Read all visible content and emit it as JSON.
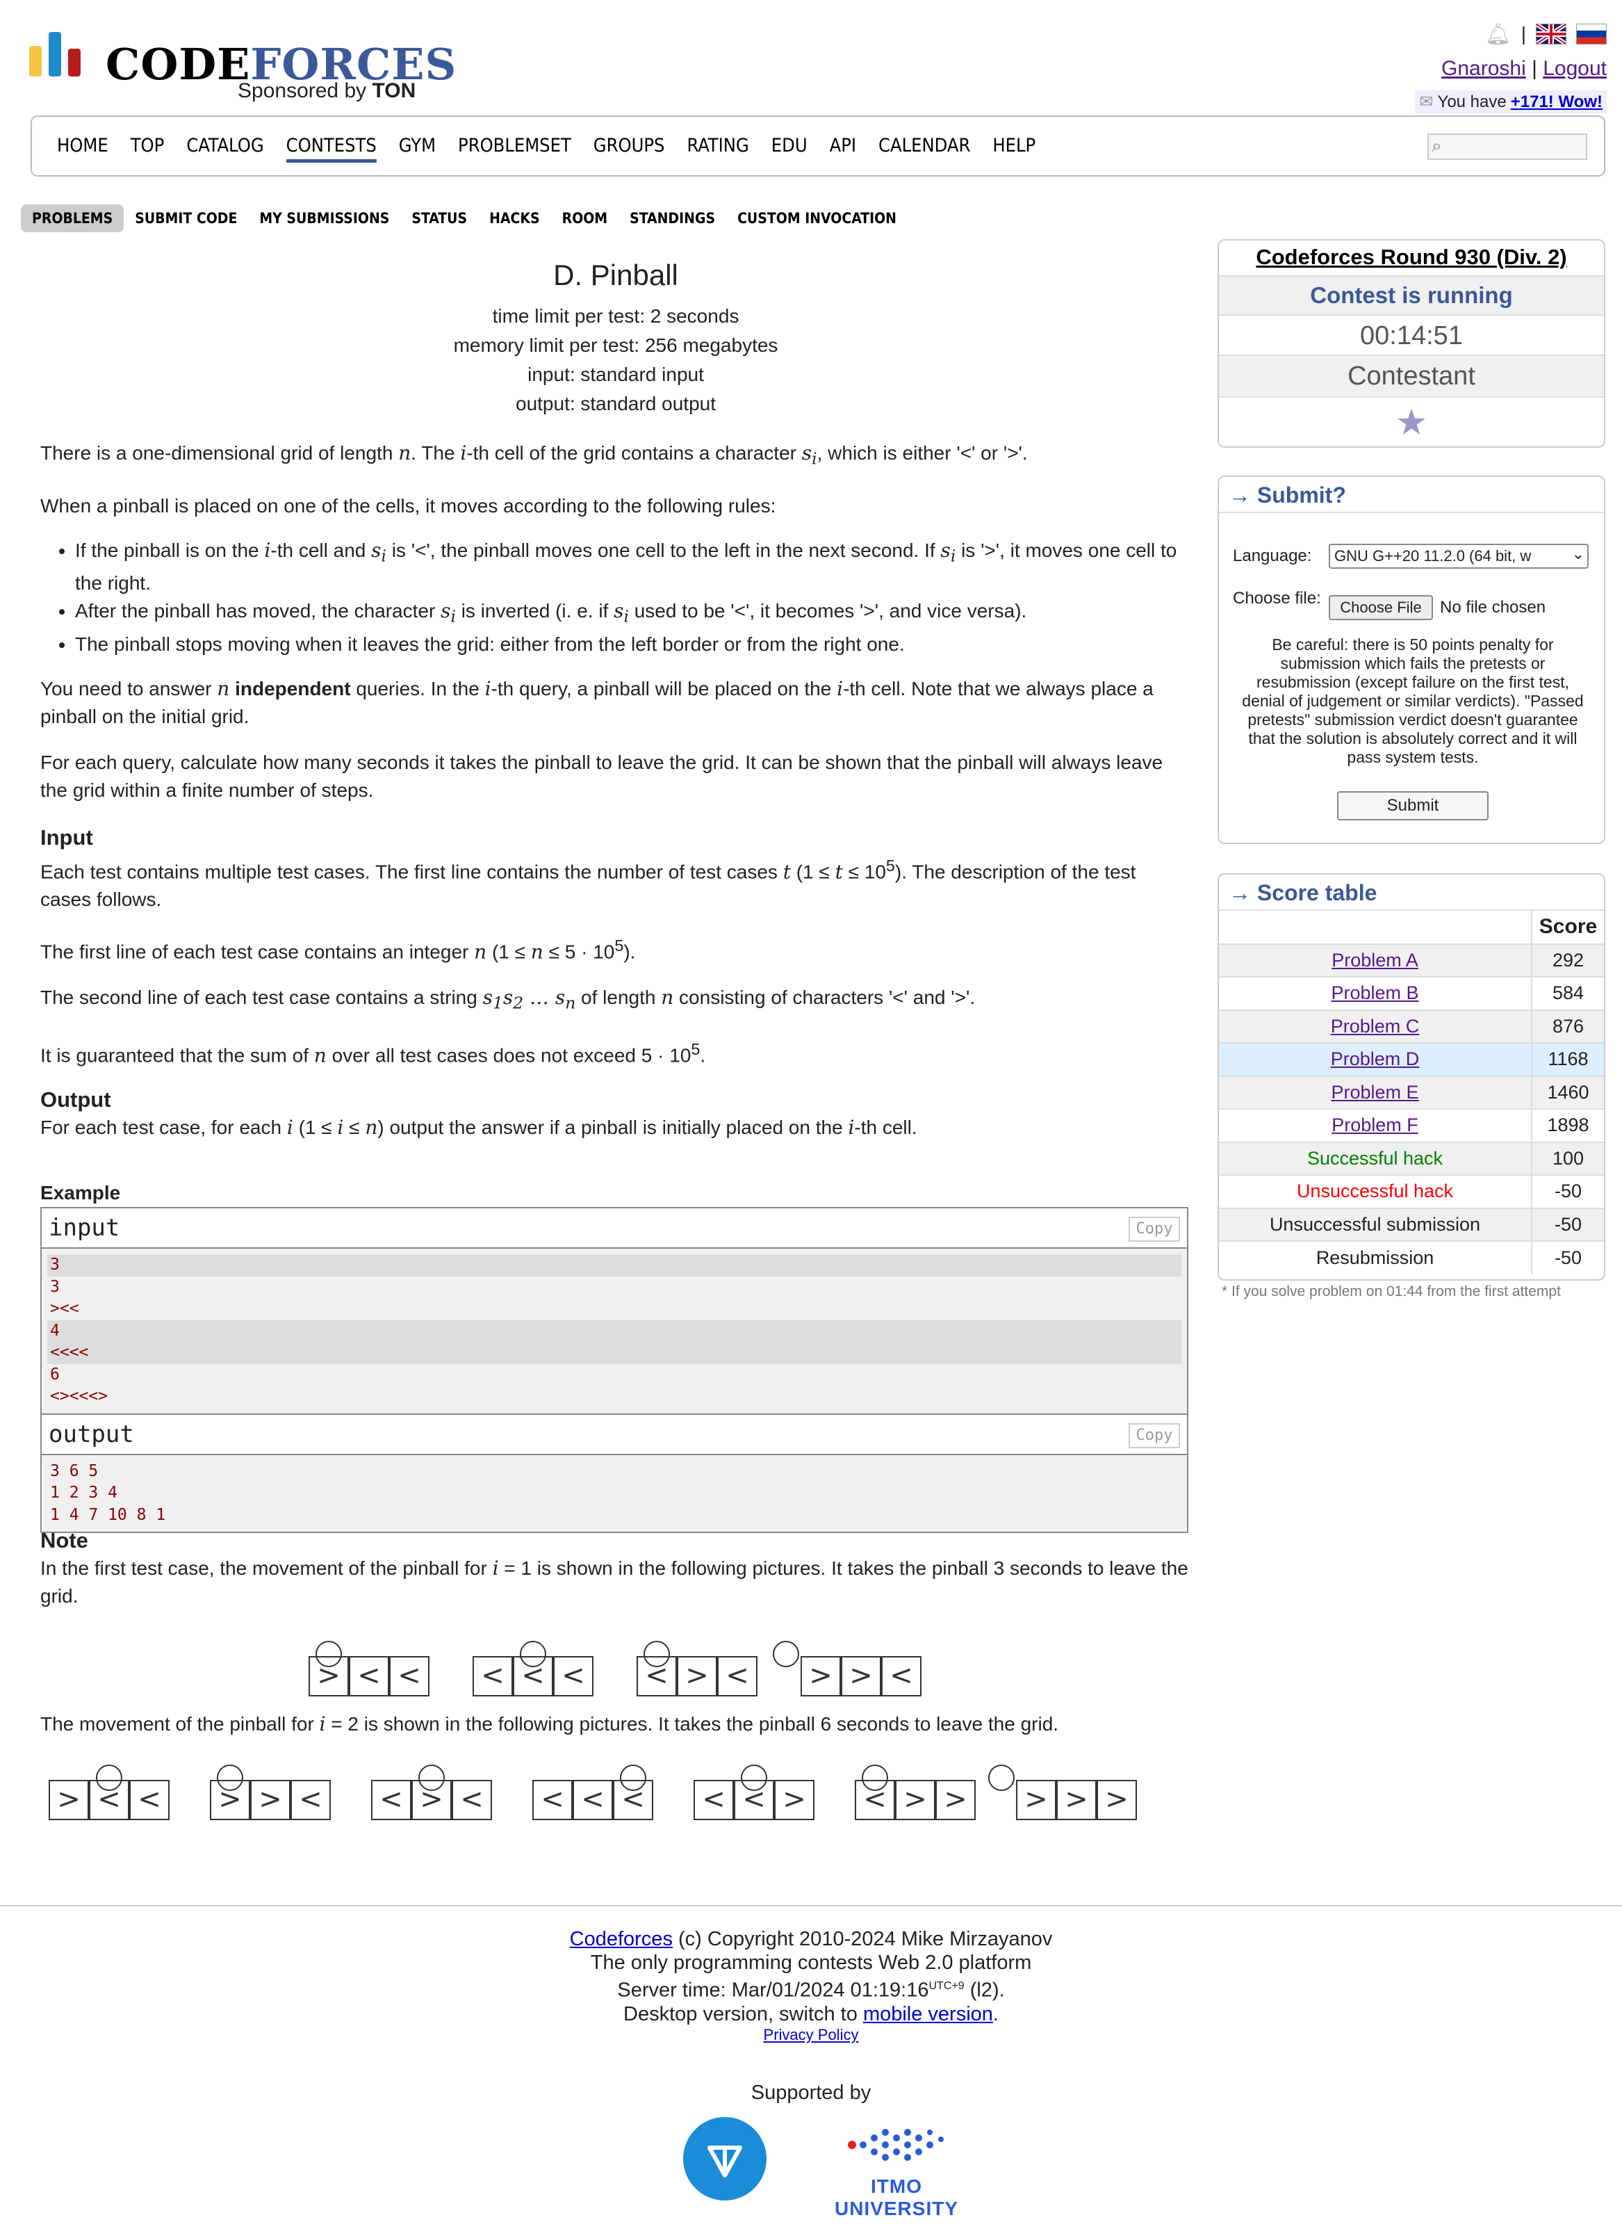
{
  "header": {
    "logo_text_code": "CODE",
    "logo_text_forces": "FORCES",
    "sponsor_prefix": "Sponsored by",
    "sponsor_name": "TON",
    "separator": "|",
    "user_name": "Gnaroshi",
    "logout": "Logout",
    "message_prefix": "You have",
    "message_link": "+171! Wow!"
  },
  "menu": [
    "HOME",
    "TOP",
    "CATALOG",
    "CONTESTS",
    "GYM",
    "PROBLEMSET",
    "GROUPS",
    "RATING",
    "EDU",
    "API",
    "CALENDAR",
    "HELP"
  ],
  "menu_active": "CONTESTS",
  "subnav": [
    "PROBLEMS",
    "SUBMIT CODE",
    "MY SUBMISSIONS",
    "STATUS",
    "HACKS",
    "ROOM",
    "STANDINGS",
    "CUSTOM INVOCATION"
  ],
  "problem": {
    "title": "D. Pinball",
    "limits": [
      "time limit per test: 2 seconds",
      "memory limit per test: 256 megabytes",
      "input: standard input",
      "output: standard output"
    ],
    "section_input": "Input",
    "section_output": "Output",
    "section_example": "Example",
    "section_note": "Note",
    "note_first": "In the first test case, the movement of the pinball for",
    "note_first_b": "is shown in the following pictures. It takes the pinball",
    "note_first_c": "seconds to leave the grid.",
    "note_second": "The movement of the pinball for",
    "note_second_b": "is shown in the following pictures. It takes the pinball",
    "note_second_c": "seconds to leave the grid."
  },
  "example": {
    "input_label": "input",
    "output_label": "output",
    "copy": "Copy",
    "input_lines": [
      "3",
      "3",
      "><<",
      "4",
      "<<<<",
      "6",
      "<><<<>"
    ],
    "output_lines": [
      "3 6 5",
      "1 2 3 4",
      "1 4 7 10 8 1"
    ]
  },
  "contest": {
    "name": "Codeforces Round 930 (Div. 2)",
    "status": "Contest is running",
    "timer": "00:14:51",
    "role": "Contestant"
  },
  "submit": {
    "title": "→ Submit?",
    "language_label": "Language:",
    "language_value": "GNU G++20 11.2.0 (64 bit, w",
    "file_label": "Choose file:",
    "file_button": "Choose File",
    "file_status": "No file chosen",
    "warning": "Be careful: there is 50 points penalty for submission which fails the pretests or resubmission (except failure on the first test, denial of judgement or similar verdicts). \"Passed pretests\" submission verdict doesn't guarantee that the solution is absolutely correct and it will pass system tests.",
    "button": "Submit"
  },
  "score_table": {
    "title": "→ Score table",
    "header": "Score",
    "rows": [
      {
        "name": "Problem A",
        "score": "292",
        "kind": "link"
      },
      {
        "name": "Problem B",
        "score": "584",
        "kind": "link"
      },
      {
        "name": "Problem C",
        "score": "876",
        "kind": "link"
      },
      {
        "name": "Problem D",
        "score": "1168",
        "kind": "link"
      },
      {
        "name": "Problem E",
        "score": "1460",
        "kind": "link"
      },
      {
        "name": "Problem F",
        "score": "1898",
        "kind": "link"
      },
      {
        "name": "Successful hack",
        "score": "100",
        "kind": "good"
      },
      {
        "name": "Unsuccessful hack",
        "score": "-50",
        "kind": "bad"
      },
      {
        "name": "Unsuccessful submission",
        "score": "-50",
        "kind": "plain"
      },
      {
        "name": "Resubmission",
        "score": "-50",
        "kind": "plain"
      }
    ],
    "footnote": "* If you solve problem on 01:44 from the first attempt"
  },
  "diagrams": {
    "first": [
      {
        "cells": [
          ">",
          "<",
          "<"
        ],
        "ball": 0
      },
      {
        "cells": [
          "<",
          "<",
          "<"
        ],
        "ball": 1
      },
      {
        "cells": [
          "<",
          ">",
          "<"
        ],
        "ball": 0
      },
      {
        "cells": [
          ">",
          ">",
          "<"
        ],
        "ball": -1
      }
    ],
    "second": [
      {
        "cells": [
          ">",
          "<",
          "<"
        ],
        "ball": 1
      },
      {
        "cells": [
          ">",
          ">",
          "<"
        ],
        "ball": 0
      },
      {
        "cells": [
          "<",
          ">",
          "<"
        ],
        "ball": 1
      },
      {
        "cells": [
          "<",
          "<",
          "<"
        ],
        "ball": 2
      },
      {
        "cells": [
          "<",
          "<",
          ">"
        ],
        "ball": 1
      },
      {
        "cells": [
          "<",
          ">",
          ">"
        ],
        "ball": 0
      },
      {
        "cells": [
          ">",
          ">",
          ">"
        ],
        "ball": -1
      }
    ]
  },
  "footer": {
    "site": "Codeforces",
    "copyright": "(c) Copyright 2010-2024 Mike Mirzayanov",
    "tagline": "The only programming contests Web 2.0 platform",
    "server_time": "Server time: Mar/01/2024 01:19:16",
    "tz": "UTC+9",
    "server_suffix": "(l2).",
    "desktop_prefix": "Desktop version, switch to",
    "mobile_link": "mobile version",
    "privacy": "Privacy Policy",
    "supported_by": "Supported by",
    "itmo": "ITMO UNIVERSITY"
  }
}
